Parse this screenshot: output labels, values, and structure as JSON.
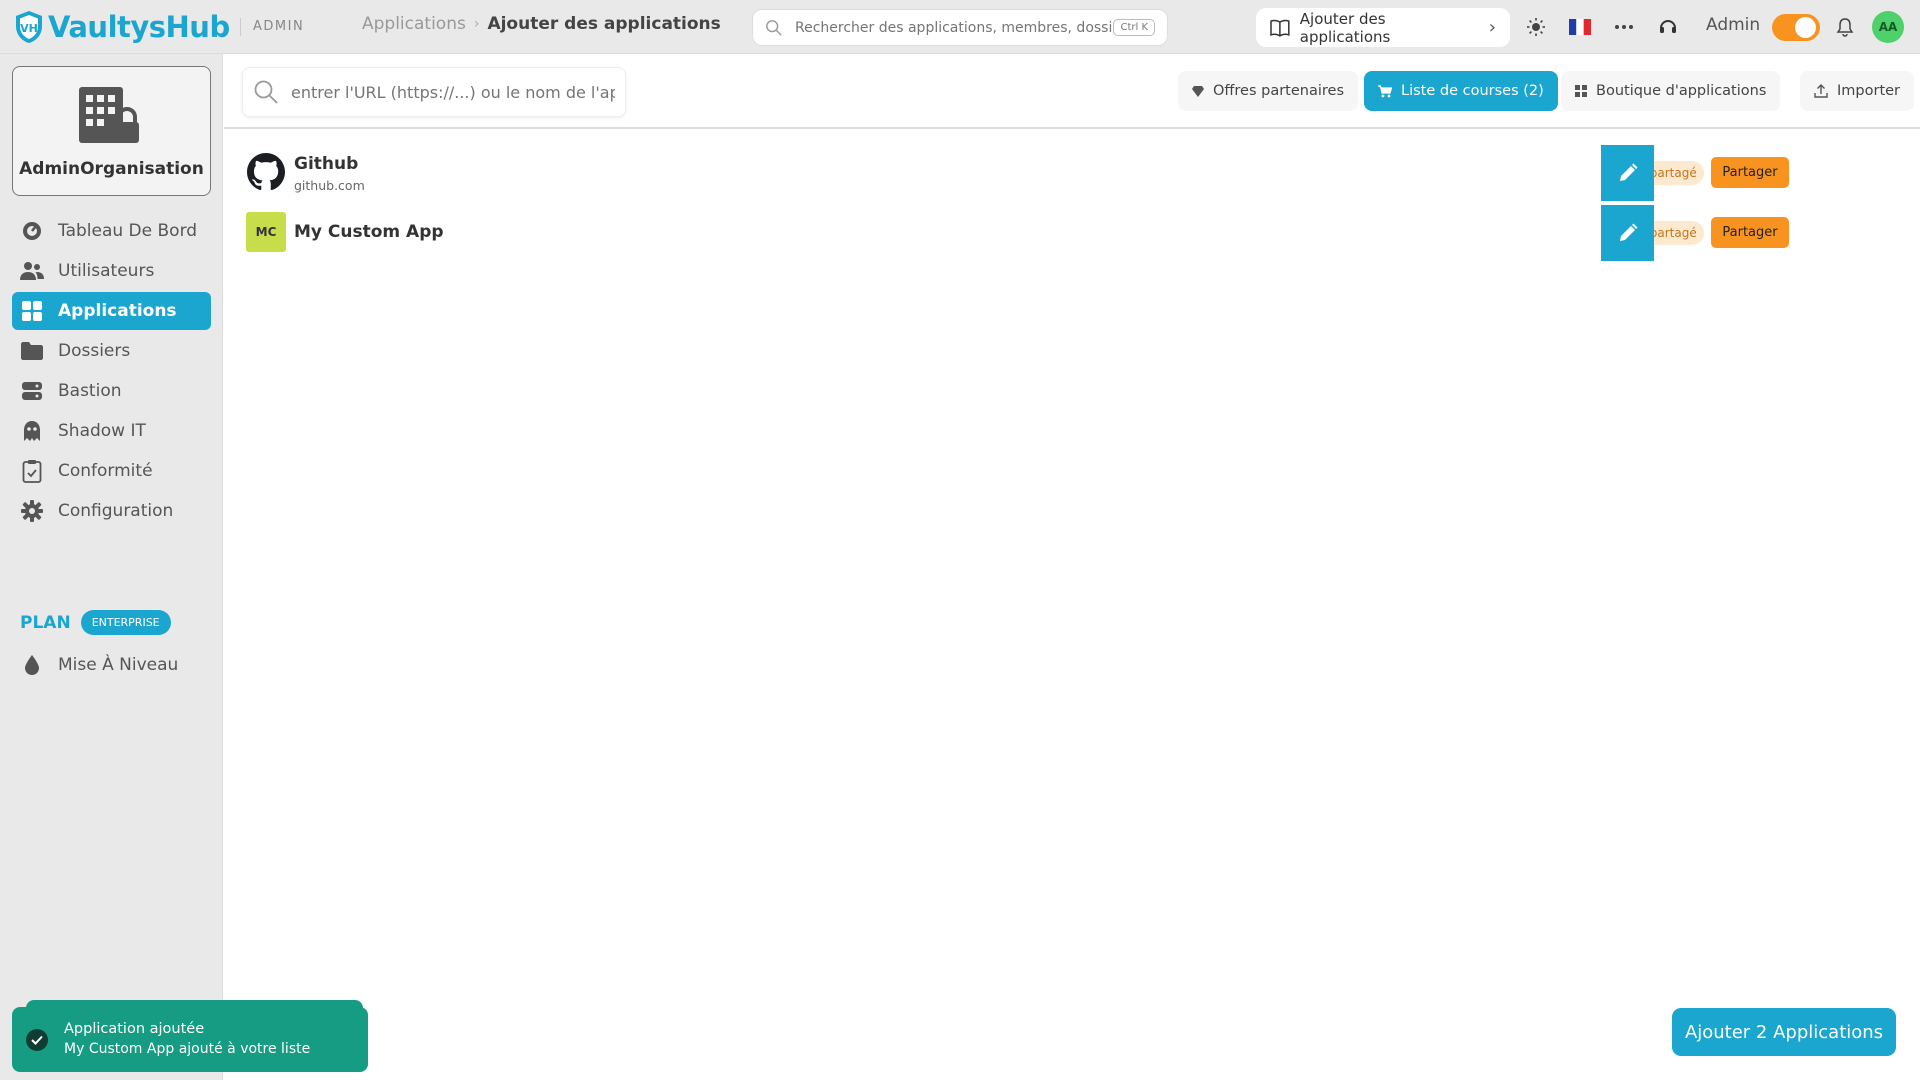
{
  "app": {
    "logo_text": "VaultysHub",
    "mode_label": "ADMIN"
  },
  "breadcrumb": {
    "parent": "Applications",
    "separator": "›",
    "current": "Ajouter des applications"
  },
  "global_search": {
    "placeholder": "Rechercher des applications, membres, dossiers",
    "shortcut": "Ctrl K"
  },
  "top_actions": {
    "add_apps_label": "Ajouter des applications",
    "user_label": "Admin",
    "avatar_initials": "AA",
    "language_flag": "🇫🇷",
    "admin_toggle_on": true
  },
  "sidebar": {
    "org_name": "AdminOrganisation",
    "items": [
      {
        "label": "Tableau De Bord",
        "icon": "dashboard-icon",
        "active": false
      },
      {
        "label": "Utilisateurs",
        "icon": "users-icon",
        "active": false
      },
      {
        "label": "Applications",
        "icon": "apps-grid-icon",
        "active": true
      },
      {
        "label": "Dossiers",
        "icon": "folder-icon",
        "active": false
      },
      {
        "label": "Bastion",
        "icon": "server-icon",
        "active": false
      },
      {
        "label": "Shadow IT",
        "icon": "ghost-icon",
        "active": false
      },
      {
        "label": "Conformité",
        "icon": "clipboard-check-icon",
        "active": false
      },
      {
        "label": "Configuration",
        "icon": "gear-icon",
        "active": false
      }
    ],
    "plan_label": "PLAN",
    "plan_badge": "ENTERPRISE",
    "upgrade_label": "Mise À Niveau"
  },
  "toolbar": {
    "url_placeholder": "entrer l'URL (https://...) ou le nom de l'application",
    "partner_offers": "Offres partenaires",
    "shopping_list": "Liste de courses (2)",
    "app_store": "Boutique d'applications",
    "import": "Importer"
  },
  "apps": [
    {
      "name": "Github",
      "domain": "github.com",
      "logo": "github-icon",
      "status": "Non partagé",
      "share_label": "Partager"
    },
    {
      "name": "My Custom App",
      "domain": "",
      "logo_initials": "MC",
      "status": "Non partagé",
      "share_label": "Partager"
    }
  ],
  "toast": {
    "title": "Application ajoutée",
    "message": "My Custom App ajouté à votre liste"
  },
  "cta": {
    "label": "Ajouter 2 Applications"
  },
  "colors": {
    "accent": "#1aa6cf",
    "orange": "#f7931e",
    "success": "#169c82",
    "avatar_bg": "#4ed06a",
    "mc_logo_bg": "#c7dd4a"
  }
}
